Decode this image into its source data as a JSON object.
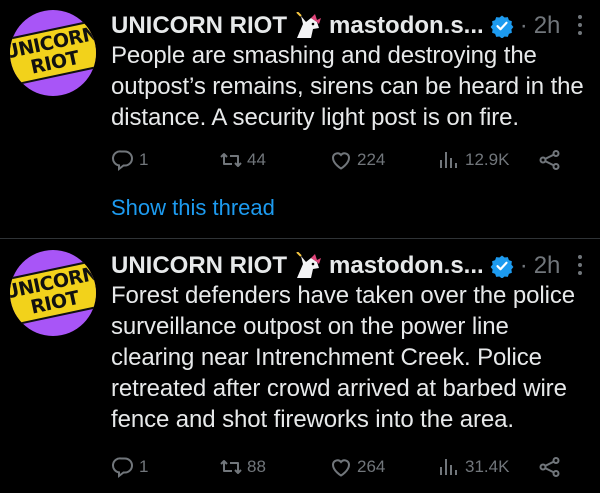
{
  "tweets": [
    {
      "author_name": "UNICORN RIOT",
      "handle": "mastodon.s...",
      "time": "2h",
      "avatar_text_line1": "UNICORN",
      "avatar_text_line2": "RIOT",
      "text": "People are smashing and destroying the outpost’s remains, sirens can be heard in the distance. A security light post is on fire.",
      "replies": "1",
      "retweets": "44",
      "likes": "224",
      "views": "12.9K",
      "show_thread": "Show this thread"
    },
    {
      "author_name": "UNICORN RIOT",
      "handle": "mastodon.s...",
      "time": "2h",
      "avatar_text_line1": "UNICORN",
      "avatar_text_line2": "RIOT",
      "text": "Forest defenders have taken over the police surveillance outpost on the power line clearing near Intrenchment Creek. Police retreated after crowd arrived at barbed wire fence and shot fireworks into the area.",
      "replies": "1",
      "retweets": "88",
      "likes": "264",
      "views": "31.4K"
    }
  ],
  "icons": {
    "emoji": "unicorn-emoji",
    "verified": "verified-badge-icon",
    "reply": "reply-icon",
    "retweet": "retweet-icon",
    "like": "heart-icon",
    "views": "views-chart-icon",
    "share": "share-icon",
    "more": "more-options-icon"
  },
  "colors": {
    "background": "#000000",
    "text": "#e7e9ea",
    "muted": "#71767b",
    "link": "#1d9bf0",
    "avatar": "#a855f7",
    "verified": "#1d9bf0"
  }
}
